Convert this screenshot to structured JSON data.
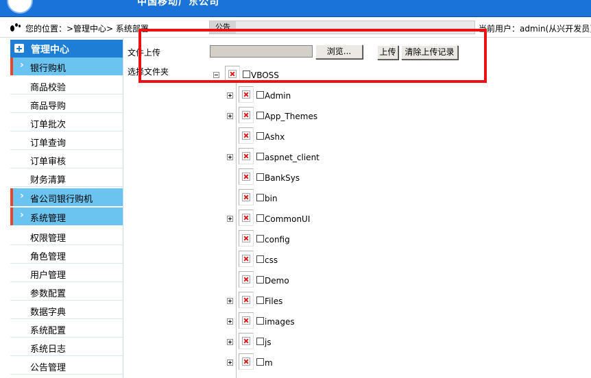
{
  "banner": {
    "title": "中国移动广东公司"
  },
  "topbar": {
    "location": "您的位置：>管理中心> 系统部署",
    "notice_tab": "公告",
    "current_user": "当前用户：admin(从兴开发员)"
  },
  "sidebar": {
    "header": "管理中心",
    "groups": [
      {
        "label": "银行购机",
        "items": [
          "商品校验",
          "商品导购",
          "订单批次",
          "订单查询",
          "订单审核",
          "财务清算"
        ]
      },
      {
        "label": "省公司银行购机",
        "items": []
      },
      {
        "label": "系统管理",
        "items": [
          "权限管理",
          "角色管理",
          "用户管理",
          "参数配置",
          "数据字典",
          "系统配置",
          "系统日志",
          "公告管理"
        ]
      }
    ]
  },
  "upload": {
    "file_label": "文件上传",
    "browse_label": "浏览...",
    "upload_label": "上传",
    "clear_label": "清除上传记录",
    "folder_label": "选择文件夹"
  },
  "tree": {
    "root": {
      "label": "VBOSS",
      "expander": "minus"
    },
    "children": [
      {
        "label": "Admin",
        "expander": "plus"
      },
      {
        "label": "App_Themes",
        "expander": "plus"
      },
      {
        "label": "Ashx",
        "expander": "none"
      },
      {
        "label": "aspnet_client",
        "expander": "plus"
      },
      {
        "label": "BankSys",
        "expander": "none"
      },
      {
        "label": "bin",
        "expander": "none"
      },
      {
        "label": "CommonUI",
        "expander": "plus"
      },
      {
        "label": "config",
        "expander": "none"
      },
      {
        "label": "css",
        "expander": "none"
      },
      {
        "label": "Demo",
        "expander": "none"
      },
      {
        "label": "Files",
        "expander": "plus"
      },
      {
        "label": "images",
        "expander": "plus"
      },
      {
        "label": "js",
        "expander": "plus"
      },
      {
        "label": "m",
        "expander": "plus"
      }
    ]
  },
  "colors": {
    "banner": "#1a73d9",
    "sidebar_header": "#1e7ed6",
    "sidebar_group": "#6bc3f0",
    "group_accent": "#e8452d",
    "highlight_box": "#ee0f14",
    "broken_image_x": "#e0191a"
  }
}
